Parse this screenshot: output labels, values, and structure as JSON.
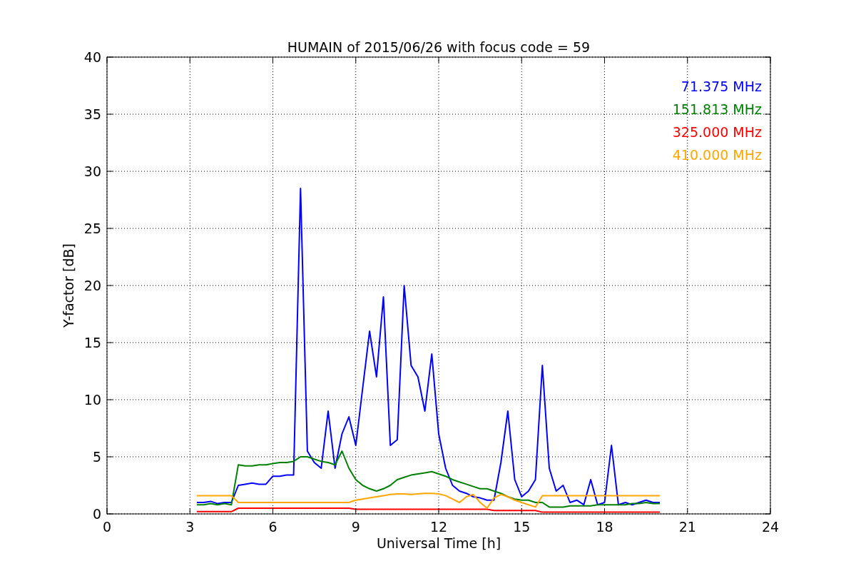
{
  "figure": {
    "chart_data": {
      "type": "line",
      "title": "HUMAIN of 2015/06/26 with focus code = 59",
      "xlabel": "Universal Time [h]",
      "ylabel": "Y-factor [dB]",
      "x": [
        3.25,
        3.5,
        3.75,
        4,
        4.25,
        4.5,
        4.75,
        5,
        5.25,
        5.5,
        5.75,
        6,
        6.25,
        6.5,
        6.75,
        7,
        7.25,
        7.5,
        7.75,
        8,
        8.25,
        8.5,
        8.75,
        9,
        9.25,
        9.5,
        9.75,
        10,
        10.25,
        10.5,
        10.75,
        11,
        11.25,
        11.5,
        11.75,
        12,
        12.25,
        12.5,
        12.75,
        13,
        13.25,
        13.5,
        13.75,
        14,
        14.25,
        14.5,
        14.75,
        15,
        15.25,
        15.5,
        15.75,
        16,
        16.25,
        16.5,
        16.75,
        17,
        17.25,
        17.5,
        17.75,
        18,
        18.25,
        18.5,
        18.75,
        19,
        19.25,
        19.5,
        19.75,
        20
      ],
      "series": [
        {
          "name": "71.375 MHz",
          "color": "#0000ff",
          "values": [
            1.0,
            1.0,
            1.1,
            0.9,
            1.0,
            1.0,
            2.5,
            2.6,
            2.7,
            2.6,
            2.6,
            3.3,
            3.3,
            3.4,
            3.4,
            28.5,
            5.5,
            4.5,
            4.0,
            9.0,
            4.0,
            7.0,
            8.5,
            6.0,
            11.0,
            16.0,
            12.0,
            19.0,
            6.0,
            6.5,
            20.0,
            13.0,
            12.0,
            9.0,
            14.0,
            7.0,
            4.0,
            2.5,
            2.0,
            1.8,
            1.5,
            1.4,
            1.2,
            1.2,
            4.5,
            9.0,
            3.0,
            1.5,
            2.0,
            3.0,
            13.0,
            4.0,
            2.0,
            2.5,
            1.0,
            1.2,
            0.8,
            3.0,
            0.8,
            1.0,
            6.0,
            0.8,
            1.0,
            0.8,
            1.0,
            1.2,
            1.0,
            1.0
          ]
        },
        {
          "name": "151.813 MHz",
          "color": "#008000",
          "values": [
            0.8,
            0.8,
            0.9,
            0.8,
            0.9,
            0.8,
            4.3,
            4.2,
            4.2,
            4.3,
            4.3,
            4.4,
            4.5,
            4.5,
            4.6,
            5.0,
            5.0,
            4.8,
            4.6,
            4.5,
            4.3,
            5.5,
            4.0,
            3.0,
            2.5,
            2.2,
            2.0,
            2.2,
            2.5,
            3.0,
            3.2,
            3.4,
            3.5,
            3.6,
            3.7,
            3.5,
            3.3,
            3.0,
            2.8,
            2.6,
            2.4,
            2.2,
            2.2,
            2.0,
            1.8,
            1.5,
            1.3,
            1.2,
            1.2,
            1.0,
            1.0,
            0.6,
            0.6,
            0.6,
            0.7,
            0.7,
            0.7,
            0.7,
            0.8,
            0.8,
            0.8,
            0.8,
            0.8,
            0.9,
            0.9,
            1.0,
            0.9,
            0.9
          ]
        },
        {
          "name": "325.000 MHz",
          "color": "#ff0000",
          "values": [
            0.2,
            0.2,
            0.2,
            0.2,
            0.2,
            0.2,
            0.5,
            0.5,
            0.5,
            0.5,
            0.5,
            0.5,
            0.5,
            0.5,
            0.5,
            0.5,
            0.5,
            0.5,
            0.5,
            0.5,
            0.5,
            0.5,
            0.5,
            0.4,
            0.4,
            0.4,
            0.4,
            0.4,
            0.4,
            0.4,
            0.4,
            0.4,
            0.4,
            0.4,
            0.4,
            0.4,
            0.4,
            0.4,
            0.4,
            0.4,
            0.4,
            0.4,
            0.4,
            0.3,
            0.3,
            0.3,
            0.3,
            0.3,
            0.3,
            0.3,
            0.15,
            0.15,
            0.15,
            0.15,
            0.15,
            0.15,
            0.15,
            0.15,
            0.15,
            0.15,
            0.15,
            0.15,
            0.15,
            0.15,
            0.15,
            0.15,
            0.15,
            0.15
          ]
        },
        {
          "name": "410.000 MHz",
          "color": "#ffa500",
          "values": [
            1.6,
            1.6,
            1.6,
            1.6,
            1.6,
            1.6,
            1.0,
            1.0,
            1.0,
            1.0,
            1.0,
            1.0,
            1.0,
            1.0,
            1.0,
            1.0,
            1.0,
            1.0,
            1.0,
            1.0,
            1.0,
            1.0,
            1.0,
            1.2,
            1.3,
            1.4,
            1.5,
            1.6,
            1.7,
            1.75,
            1.75,
            1.7,
            1.75,
            1.8,
            1.8,
            1.75,
            1.6,
            1.3,
            1.0,
            1.5,
            1.7,
            1.0,
            0.5,
            1.4,
            1.7,
            1.5,
            1.2,
            1.0,
            0.8,
            0.6,
            1.6,
            1.6,
            1.6,
            1.6,
            1.6,
            1.6,
            1.6,
            1.6,
            1.6,
            1.6,
            1.6,
            1.6,
            1.6,
            1.6,
            1.6,
            1.6,
            1.6,
            1.6
          ]
        }
      ],
      "xlim": [
        0,
        24
      ],
      "ylim": [
        0,
        40
      ],
      "grid": true,
      "xticks": [
        0,
        3,
        6,
        9,
        12,
        15,
        18,
        21,
        24
      ],
      "yticks": [
        0,
        5,
        10,
        15,
        20,
        25,
        30,
        35,
        40
      ]
    }
  }
}
